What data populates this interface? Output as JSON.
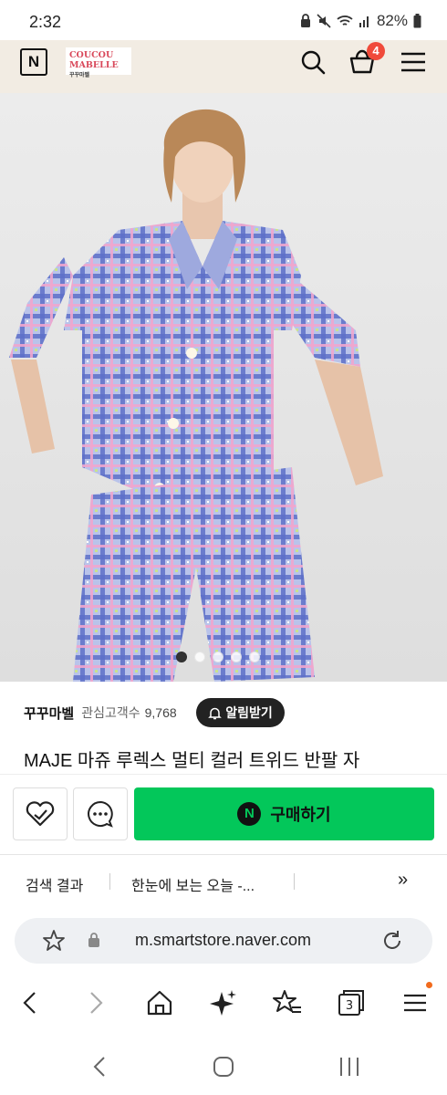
{
  "status_bar": {
    "time": "2:32",
    "battery": "82%"
  },
  "header": {
    "brand_line1": "COUCOU",
    "brand_line2": "MABELLE",
    "brand_line3": "꾸꾸마벨",
    "cart_count": "4",
    "icons": [
      "naver-n-icon",
      "search-icon",
      "cart-icon",
      "menu-icon"
    ]
  },
  "carousel": {
    "total": 5,
    "active": 1
  },
  "store": {
    "name": "꾸꾸마벨",
    "fan_label": "관심고객수",
    "fan_count": "9,768",
    "alert_label": "알림받기"
  },
  "product": {
    "title": "MAJE 마쥬 루렉스 멀티 컬러 트위드 반팔 자"
  },
  "actions": {
    "buy_label": "구매하기",
    "buy_badge": "N"
  },
  "related": {
    "item1": "검색 결과",
    "item2": "한눈에 보는 오늘 -...",
    "more": "»"
  },
  "browser": {
    "url": "m.smartstore.naver.com"
  },
  "colors": {
    "naver_green": "#03c75a",
    "header_bg": "#f2ece3",
    "badge_red": "#f04a3a"
  }
}
